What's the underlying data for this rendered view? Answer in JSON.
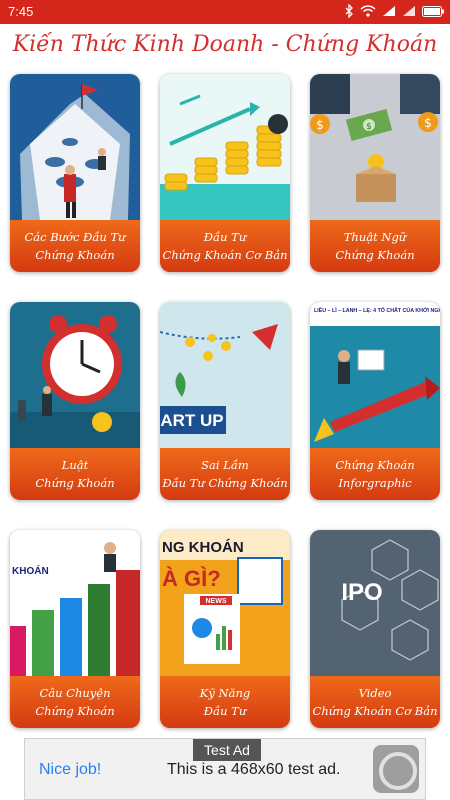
{
  "status": {
    "time": "7:45"
  },
  "app_title": "Kiến Thức Kinh Doanh - Chứng Khoán",
  "cards": [
    {
      "line1": "Các Bước Đầu Tư",
      "line2": "Chứng Khoán"
    },
    {
      "line1": "Đầu Tư",
      "line2": "Chứng Khoán Cơ Bản"
    },
    {
      "line1": "Thuật Ngữ",
      "line2": "Chứng Khoán"
    },
    {
      "line1": "Luật",
      "line2": "Chứng Khoán"
    },
    {
      "line1": "Sai Lầm",
      "line2": "Đầu Tư Chứng Khoán"
    },
    {
      "line1": "Chứng Khoán",
      "line2": "Inforgraphic"
    },
    {
      "line1": "Câu Chuyện",
      "line2": "Chứng Khoán"
    },
    {
      "line1": "Kỹ Năng",
      "line2": "Đầu Tư"
    },
    {
      "line1": "Video",
      "line2": "Chứng Khoán Cơ Bản"
    }
  ],
  "thumb_text": {
    "card4_banner": "ART UP",
    "card5_caption": "LIỀU – LÌ – LANH – LẸ: 4 TỐ CHẤT CỦA KHỞI NGHIỆP THÀNH CÔNG",
    "card7_top": "NG KHOÁN",
    "card7_big": "À GÌ?",
    "card7_news": "NEWS",
    "card6_side": "KHOÁN",
    "card8_ipo": "IPO"
  },
  "ad": {
    "badge": "Test Ad",
    "nice": "Nice job!",
    "message": "This is a 468x60 test ad."
  },
  "colors": {
    "statusbar": "#d4261b",
    "title": "#d32f2f",
    "label_top": "#ef6a1a",
    "label_bottom": "#d43a10"
  }
}
